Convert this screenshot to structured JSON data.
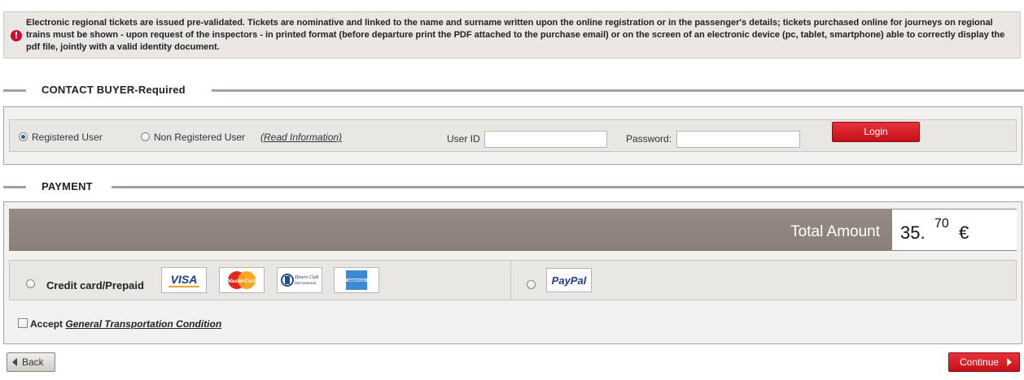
{
  "notice": {
    "icon": "alert-icon",
    "text": "Electronic regional tickets are issued pre-validated. Tickets are nominative and linked to the name and surname written upon the online registration or in the passenger's details; tickets purchased online for journeys on regional trains must be shown - upon request of the inspectors - in printed format (before departure print the PDF attached to the purchase email) or on the screen of an electronic device (pc, tablet, smartphone) able to correctly display the pdf file, jointly with a valid identity document."
  },
  "contact": {
    "title": "CONTACT BUYER-Required",
    "registered_label": "Registered User",
    "non_registered_label": "Non Registered User",
    "read_info_link": "(Read Information)",
    "userid_label": "User ID",
    "userid_value": "",
    "password_label": "Password:",
    "password_value": "",
    "login_label": "Login"
  },
  "payment": {
    "title": "PAYMENT",
    "total_label": "Total Amount",
    "total_integer": "35.",
    "total_decimal": "70",
    "currency": "€",
    "credit_card_label": "Credit card/Prepaid",
    "cards": [
      {
        "name": "VISA",
        "icon": "visa-logo"
      },
      {
        "name": "MasterCard",
        "icon": "mastercard-logo"
      },
      {
        "name": "Diners Club International",
        "icon": "diners-club-logo"
      },
      {
        "name": "American Express",
        "icon": "amex-logo"
      }
    ],
    "paypal": {
      "name": "PayPal",
      "icon": "paypal-logo"
    },
    "accept_label": "Accept",
    "accept_link": "General Transportation Condition"
  },
  "nav": {
    "back_label": "Back",
    "continue_label": "Continue"
  },
  "colors": {
    "brand_red": "#c4101a",
    "header_bar": "#8a7f78",
    "section_rule": "#a7a09a"
  }
}
